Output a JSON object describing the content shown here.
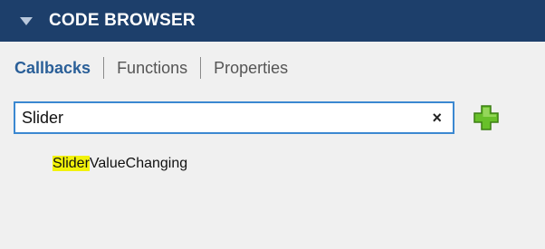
{
  "panel": {
    "title": "CODE BROWSER"
  },
  "tabs": [
    {
      "label": "Callbacks",
      "active": true
    },
    {
      "label": "Functions",
      "active": false
    },
    {
      "label": "Properties",
      "active": false
    }
  ],
  "search": {
    "value": "Slider",
    "clear_icon": "×"
  },
  "results": [
    {
      "match": "Slider",
      "rest": "ValueChanging"
    }
  ],
  "colors": {
    "header_bg": "#1d3f6b",
    "active_tab": "#2a5f98",
    "search_border": "#3b88d1",
    "highlight": "#f2f20a",
    "add_icon": "#68c02a"
  },
  "icons": {
    "collapse": "caret-down-icon",
    "clear": "close-icon",
    "add": "plus-icon"
  }
}
